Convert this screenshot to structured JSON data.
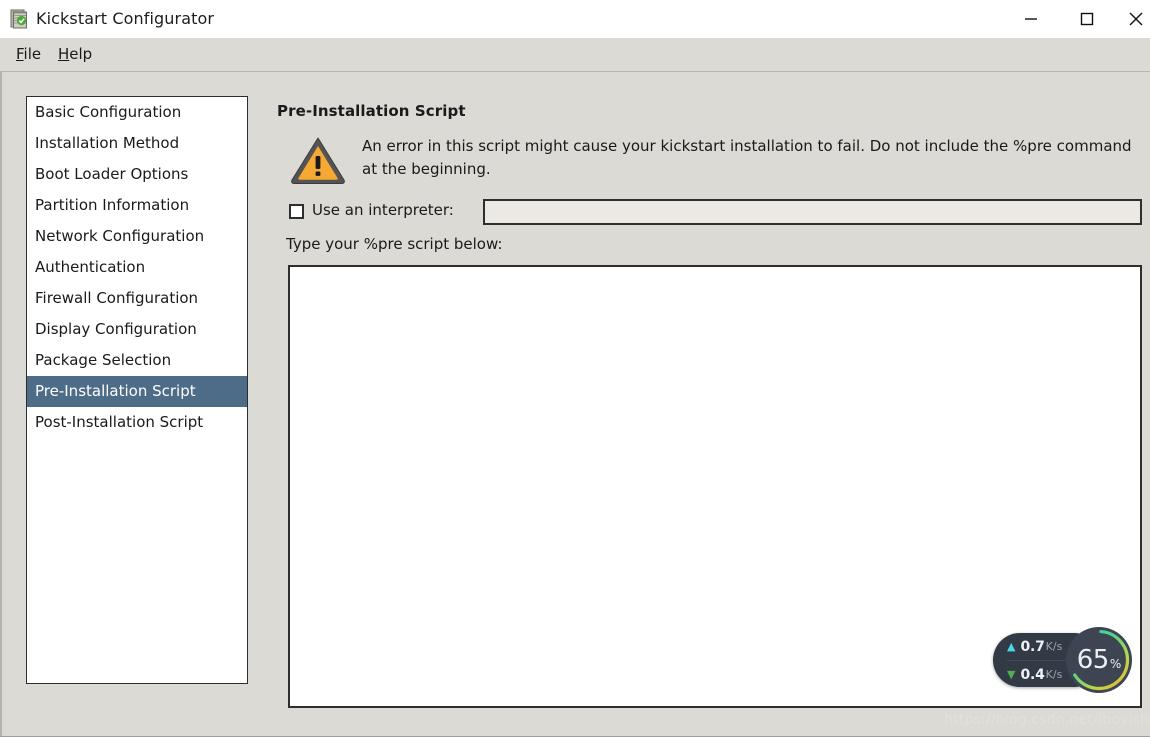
{
  "window": {
    "title": "Kickstart Configurator",
    "app_icon": "kickstart-app-icon",
    "controls": {
      "minimize": "—",
      "maximize": "□",
      "close": "✕"
    }
  },
  "menubar": {
    "items": [
      {
        "label": "File",
        "accel": "F",
        "rest": "ile"
      },
      {
        "label": "Help",
        "accel": "H",
        "rest": "elp"
      }
    ]
  },
  "sidebar": {
    "selected": "Pre-Installation Script",
    "items": [
      {
        "label": "Basic Configuration"
      },
      {
        "label": "Installation Method"
      },
      {
        "label": "Boot Loader Options"
      },
      {
        "label": "Partition Information"
      },
      {
        "label": "Network Configuration"
      },
      {
        "label": "Authentication"
      },
      {
        "label": "Firewall Configuration"
      },
      {
        "label": "Display Configuration"
      },
      {
        "label": "Package Selection"
      },
      {
        "label": "Pre-Installation Script"
      },
      {
        "label": "Post-Installation Script"
      }
    ]
  },
  "pane": {
    "title": "Pre-Installation Script",
    "warning_icon": "warning-triangle-icon",
    "warning_text": "An error in this script might cause your kickstart installation to fail. Do not include the %pre command at the beginning.",
    "interpreter": {
      "label": "Use an interpreter:",
      "checked": false,
      "value": "",
      "placeholder": ""
    },
    "script": {
      "label": "Type your %pre script below:",
      "value": "",
      "placeholder": ""
    }
  },
  "net_widget": {
    "upload": {
      "icon": "arrow-up-icon",
      "value": "0.7",
      "unit": "K/s",
      "color": "#4ad9e4"
    },
    "download": {
      "icon": "arrow-down-icon",
      "value": "0.4",
      "unit": "K/s",
      "color": "#4caf50"
    },
    "gauge": {
      "number": "65",
      "sign": "%",
      "percent": 65
    }
  },
  "watermark": {
    "text": "https://blog.csdn.net/iboyish"
  },
  "colors": {
    "window_bg": "#dcdad5",
    "titlebar_bg": "#ffffff",
    "selection_blue": "#4d6c88",
    "warning_orange": "#f5a833",
    "border_dark": "#2e2e2e",
    "disabled_field": "#ece9e4"
  }
}
